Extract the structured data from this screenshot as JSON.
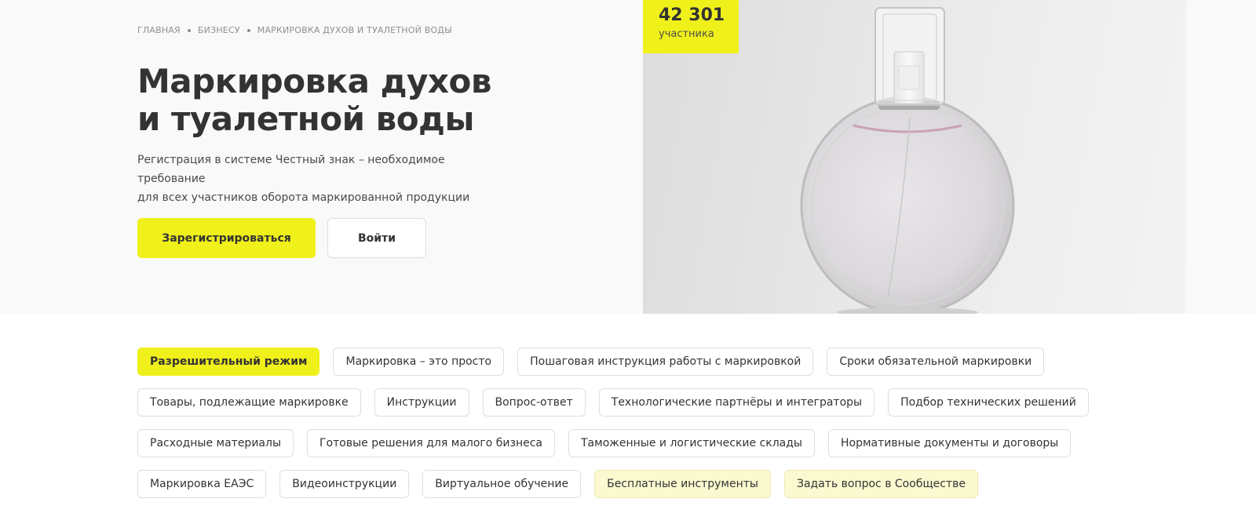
{
  "breadcrumb": {
    "items": [
      "Главная",
      "Бизнесу",
      "Маркировка духов и туалетной воды"
    ]
  },
  "hero": {
    "title_line1": "Маркировка духов",
    "title_line2": "и туалетной воды",
    "subtitle_line1": "Регистрация в системе Честный знак – необходимое требование",
    "subtitle_line2": "для всех участников оборота маркированной продукции",
    "register_label": "Зарегистрироваться",
    "login_label": "Войти"
  },
  "counter": {
    "value": "42 301",
    "label": "участника"
  },
  "colors": {
    "accent": "#f0f01b",
    "soft_accent": "#fbf9cf",
    "text": "#333333"
  },
  "chips": {
    "row1": [
      "Разрешительный режим",
      "Маркировка – это просто",
      "Пошаговая инструкция работы с маркировкой",
      "Сроки обязательной маркировки"
    ],
    "row2": [
      "Товары, подлежащие маркировке",
      "Инструкции",
      "Вопрос-ответ",
      "Технологические партнёры и интеграторы",
      "Подбор технических решений"
    ],
    "row3": [
      "Расходные материалы",
      "Готовые решения для малого бизнеса",
      "Таможенные и логистические склады",
      "Нормативные документы и договоры"
    ],
    "row4": [
      "Маркировка ЕАЭС",
      "Видеоинструкции",
      "Виртуальное обучение",
      "Бесплатные инструменты",
      "Задать вопрос в Сообществе"
    ]
  }
}
